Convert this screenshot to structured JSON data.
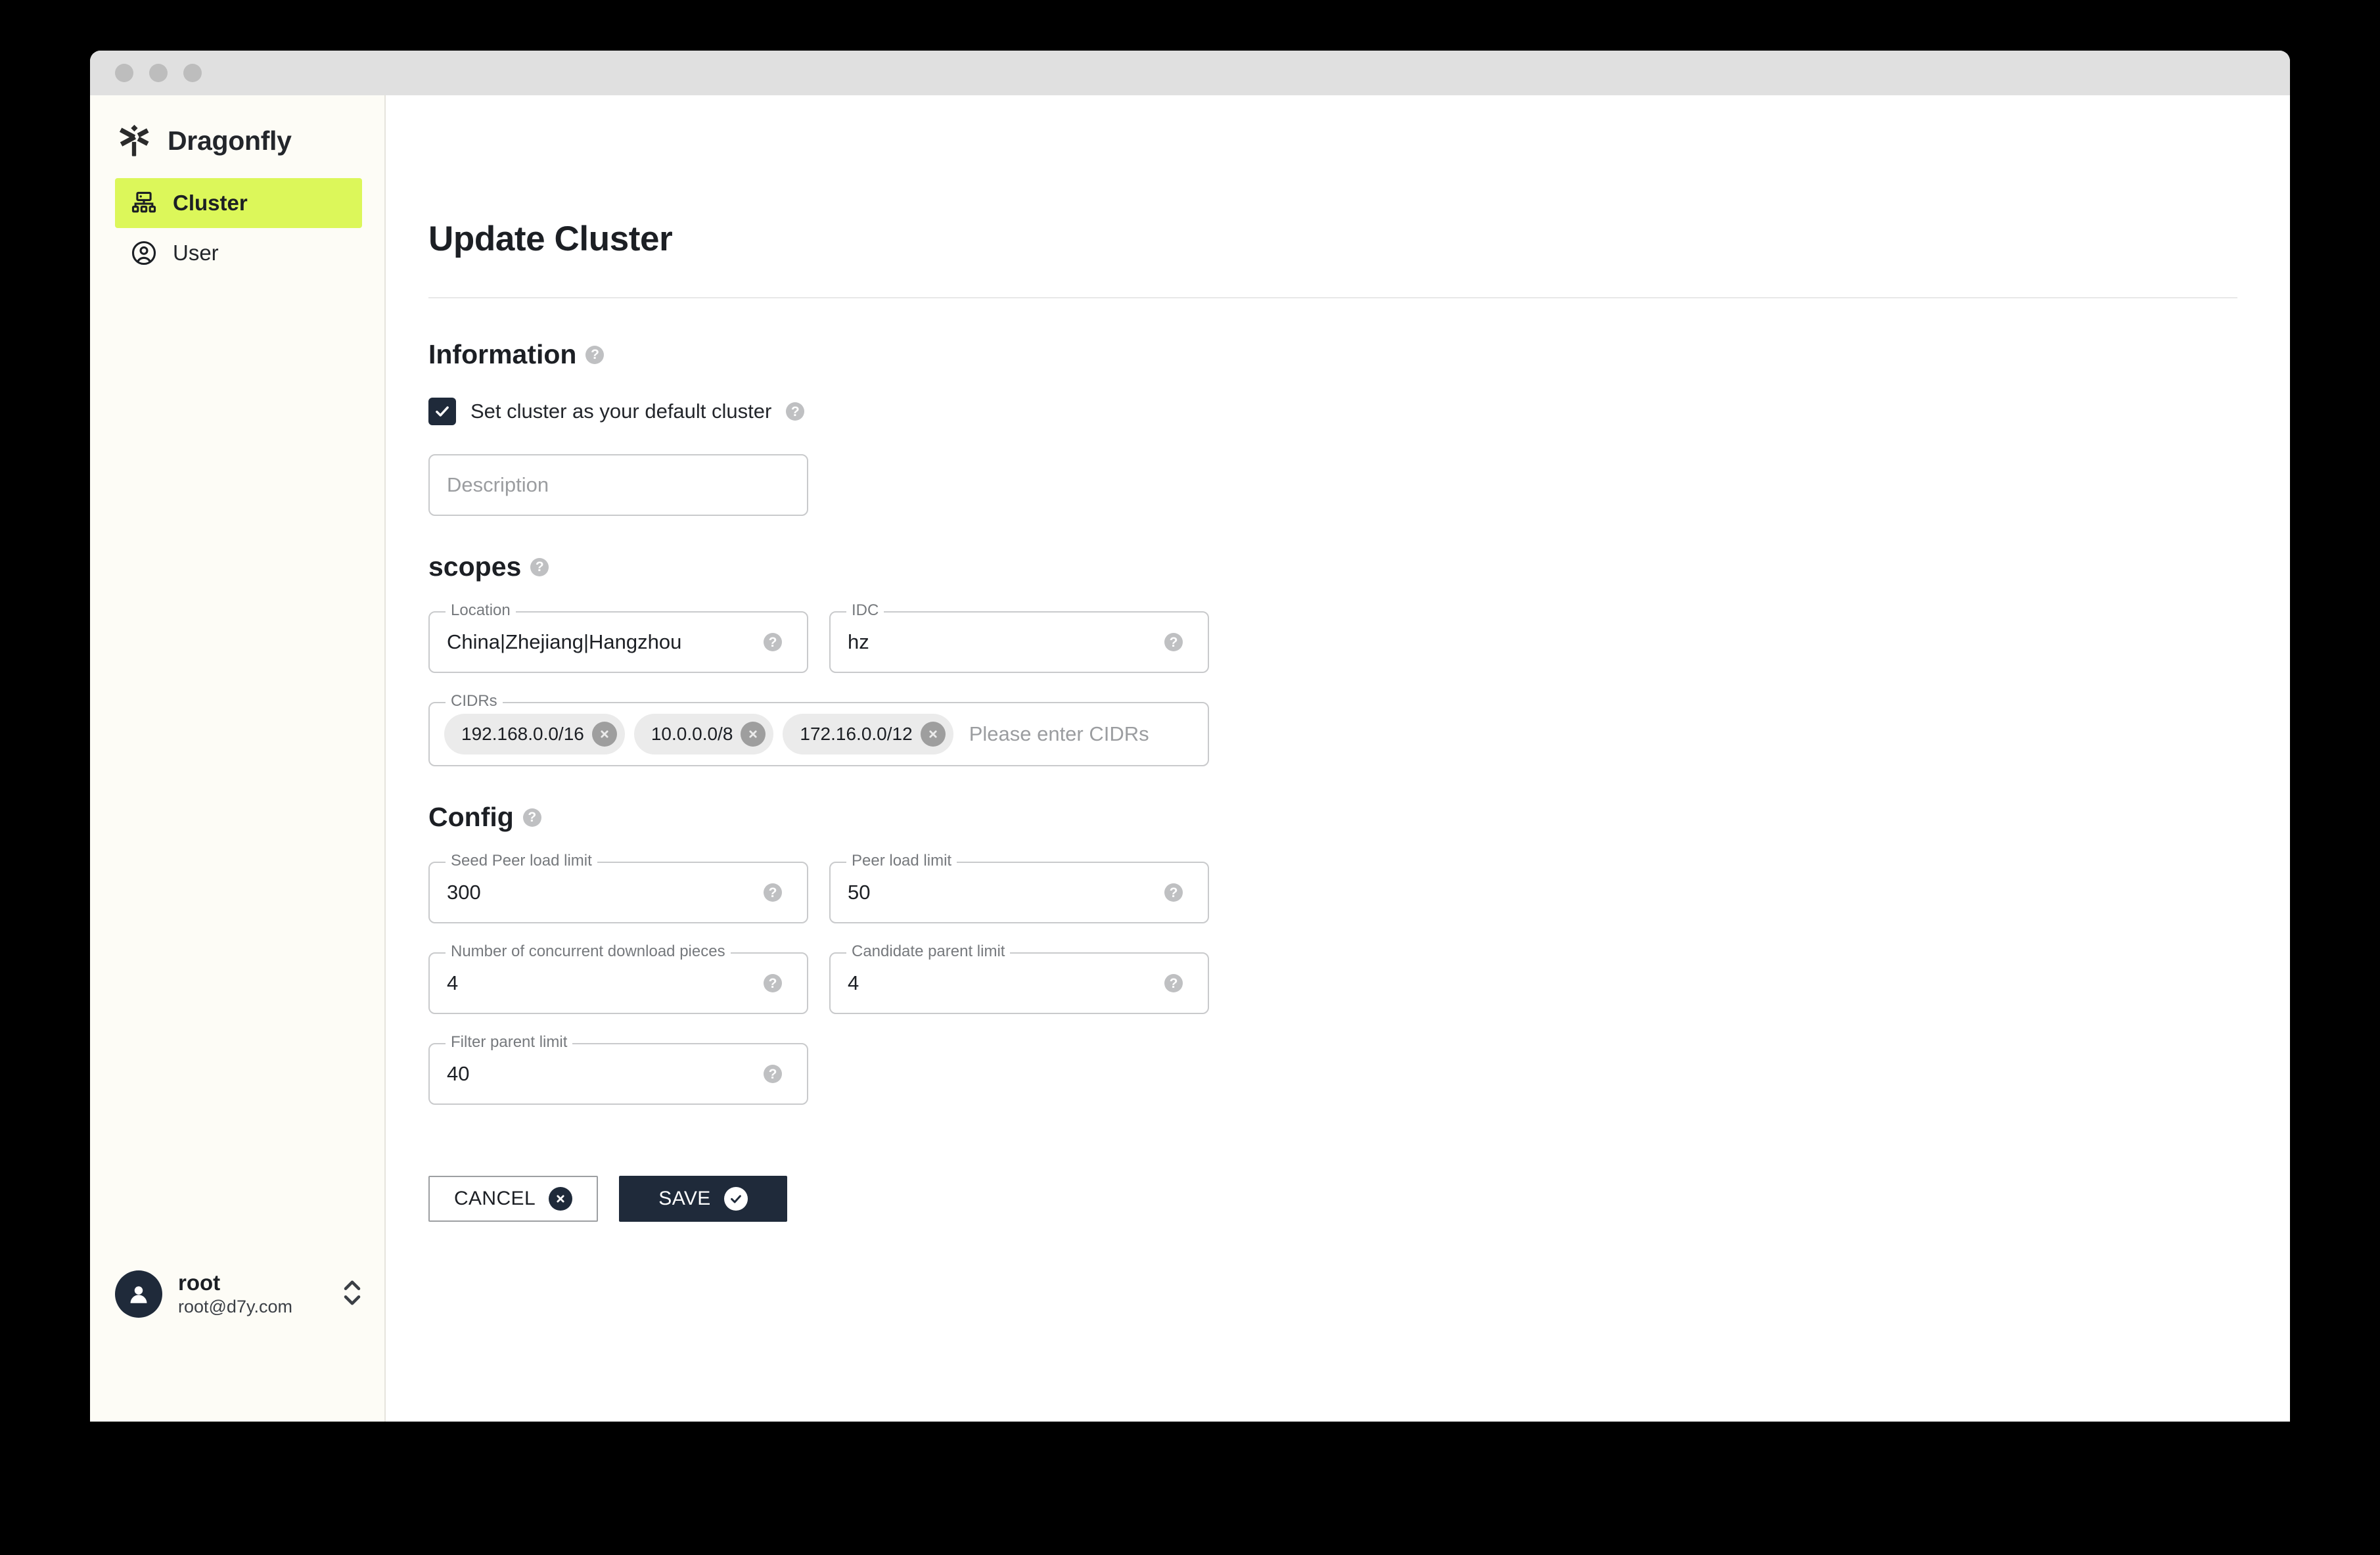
{
  "window": {
    "traffic_lights": [
      "close",
      "minimize",
      "maximize"
    ]
  },
  "sidebar": {
    "brand": {
      "name": "Dragonfly",
      "logo_icon": "dragonfly-logo-icon"
    },
    "items": [
      {
        "label": "Cluster",
        "icon": "cluster-icon",
        "active": true
      },
      {
        "label": "User",
        "icon": "user-circle-icon",
        "active": false
      }
    ],
    "user": {
      "name": "root",
      "email": "root@d7y.com",
      "avatar_icon": "avatar-person-icon",
      "expander_icon": "chevron-up-down-icon"
    }
  },
  "main": {
    "page_title": "Update Cluster",
    "sections": {
      "information": {
        "title": "Information",
        "help_icon": "help-icon",
        "default_cluster_checkbox": {
          "label": "Set cluster as your default cluster",
          "checked": true,
          "help_icon": "help-icon"
        },
        "description": {
          "placeholder": "Description",
          "value": ""
        }
      },
      "scopes": {
        "title": "scopes",
        "help_icon": "help-icon",
        "location": {
          "legend": "Location",
          "value": "China|Zhejiang|Hangzhou"
        },
        "idc": {
          "legend": "IDC",
          "value": "hz"
        },
        "cidrs": {
          "legend": "CIDRs",
          "placeholder": "Please enter CIDRs",
          "chips": [
            "192.168.0.0/16",
            "10.0.0.0/8",
            "172.16.0.0/12"
          ]
        }
      },
      "config": {
        "title": "Config",
        "help_icon": "help-icon",
        "fields": [
          {
            "legend": "Seed Peer load limit",
            "value": "300"
          },
          {
            "legend": "Peer load limit",
            "value": "50"
          },
          {
            "legend": "Number of concurrent download pieces",
            "value": "4"
          },
          {
            "legend": "Candidate parent limit",
            "value": "4"
          },
          {
            "legend": "Filter parent limit",
            "value": "40"
          }
        ]
      }
    },
    "actions": {
      "cancel_label": "CANCEL",
      "cancel_icon": "close-circle-icon",
      "save_label": "SAVE",
      "save_icon": "check-circle-icon"
    }
  },
  "colors": {
    "accent_lime": "#dcf75a",
    "dark_navy": "#1f2a3a",
    "sidebar_bg": "#fdfcf6",
    "titlebar_bg": "#e0e0e0"
  }
}
